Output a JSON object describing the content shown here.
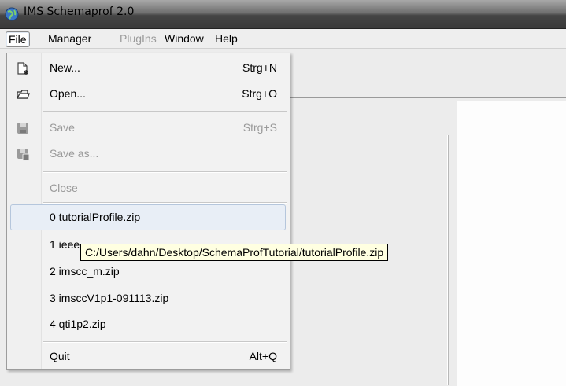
{
  "window": {
    "title": "IMS Schemaprof 2.0",
    "icon": "globe-icon"
  },
  "menubar": [
    {
      "label": "File",
      "state": "open"
    },
    {
      "label": "Manager",
      "state": "enabled"
    },
    {
      "label": "PlugIns",
      "state": "disabled"
    },
    {
      "label": "Window",
      "state": "enabled"
    },
    {
      "label": "Help",
      "state": "enabled"
    }
  ],
  "file_menu": {
    "new": {
      "label": "New...",
      "shortcut": "Strg+N",
      "icon": "new-document-icon"
    },
    "open": {
      "label": "Open...",
      "shortcut": "Strg+O",
      "icon": "open-folder-icon"
    },
    "save": {
      "label": "Save",
      "shortcut": "Strg+S",
      "icon": "save-disk-icon",
      "enabled": false
    },
    "save_as": {
      "label": "Save as...",
      "icon": "save-as-disk-icon",
      "enabled": false
    },
    "close": {
      "label": "Close",
      "enabled": false
    },
    "recent": [
      "0 tutorialProfile.zip",
      "1 ieee",
      "2 imscc_m.zip",
      "3 imsccV1p1-091113.zip",
      "4 qti1p2.zip"
    ],
    "quit": {
      "label": "Quit",
      "shortcut": "Alt+Q"
    }
  },
  "tooltip": "C:/Users/dahn/Desktop/SchemaProfTutorial/tutorialProfile.zip",
  "colors": {
    "menu_hover": "#e8eef6",
    "tooltip_bg": "#ffffe1",
    "disabled_text": "#9a9a9a"
  }
}
